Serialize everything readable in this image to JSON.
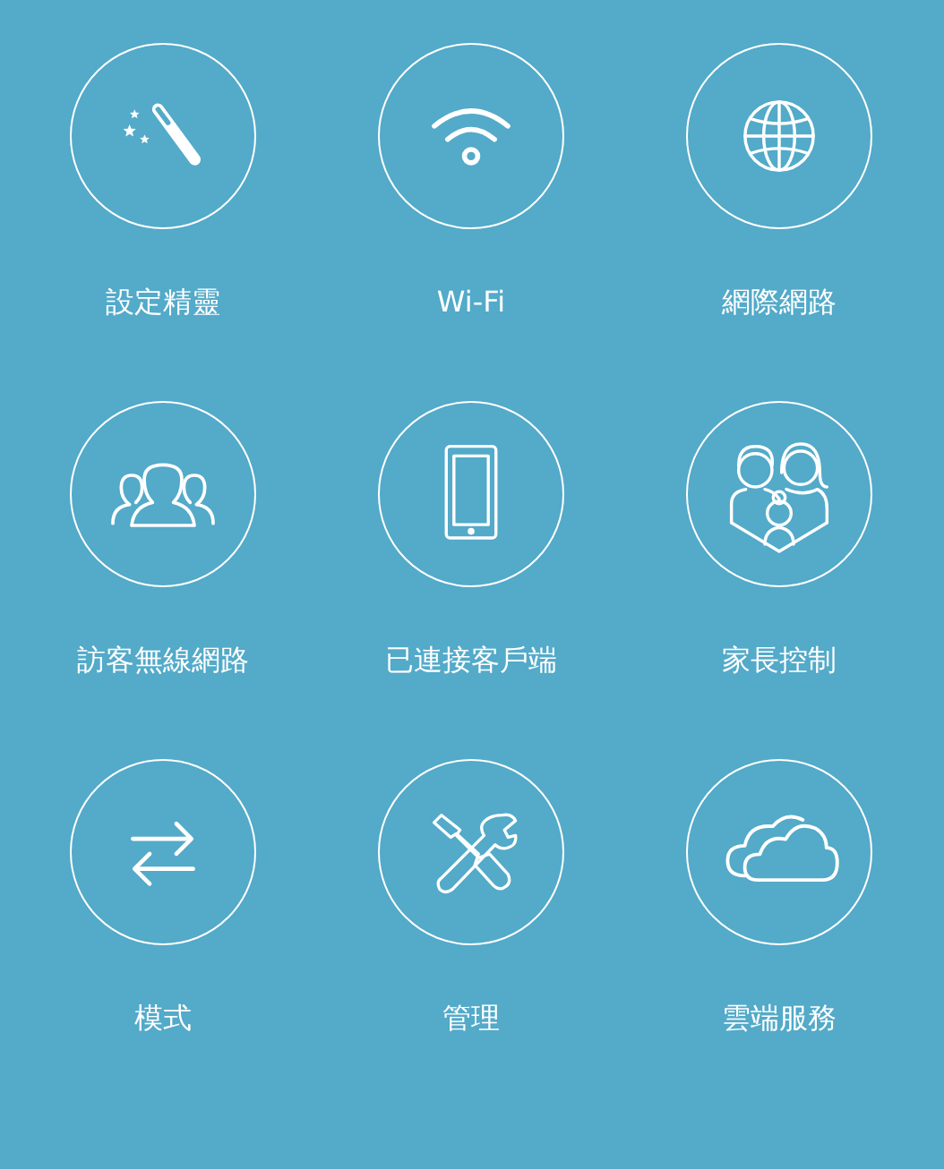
{
  "tiles": [
    {
      "kind": "wand",
      "label": "設定精靈"
    },
    {
      "kind": "wifi",
      "label": "Wi-Fi"
    },
    {
      "kind": "globe",
      "label": "網際網路"
    },
    {
      "kind": "guests",
      "label": "訪客無線網路"
    },
    {
      "kind": "tablet",
      "label": "已連接客戶端"
    },
    {
      "kind": "family",
      "label": "家長控制"
    },
    {
      "kind": "swap",
      "label": "模式"
    },
    {
      "kind": "tools",
      "label": "管理"
    },
    {
      "kind": "cloud",
      "label": "雲端服務"
    }
  ]
}
